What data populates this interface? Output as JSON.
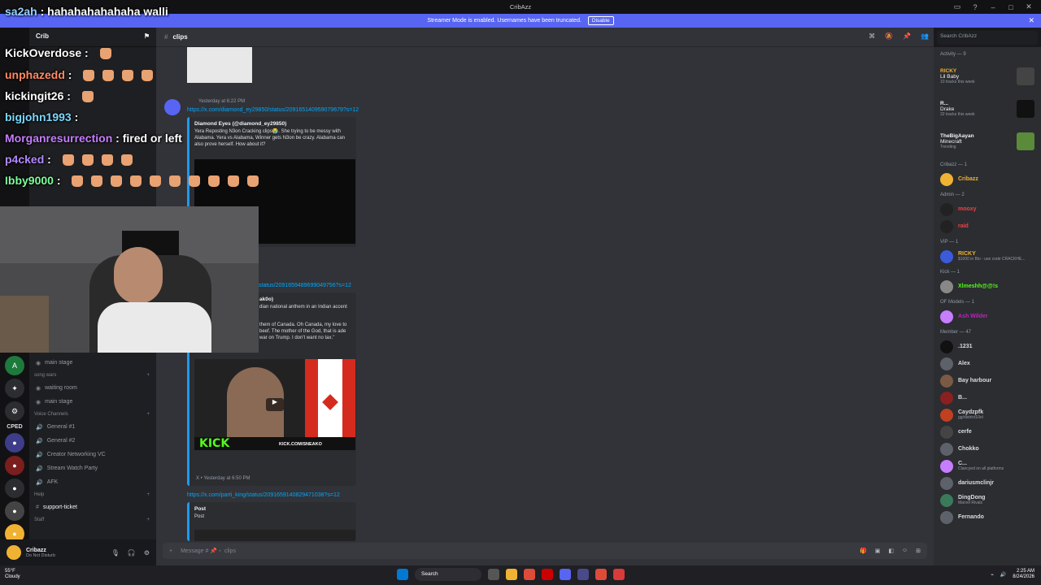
{
  "window": {
    "title": "CribAzz"
  },
  "banner": {
    "message": "Streamer Mode is enabled. Usernames have been truncated.",
    "button": "Disable"
  },
  "server": {
    "name": "Crib"
  },
  "channels": {
    "items": [
      "main stage",
      "waiting room",
      "main stage"
    ],
    "category_song": "song wars",
    "category_voice": "Voice Channels",
    "voice": [
      "General #1",
      "General #2",
      "Creator Networking VC",
      "Stream Watch Party",
      "AFK"
    ],
    "category_help": "Help",
    "help_items": [
      "support-ticket"
    ],
    "category_staff": "Staff",
    "server_label": "CPED"
  },
  "user": {
    "name": "Cribazz",
    "status": "Do Not Disturb"
  },
  "channel_header": {
    "name": "clips"
  },
  "search": {
    "placeholder": "Search CribAzz"
  },
  "messages": {
    "link1": "https://x.com/diamond_ey29850/status/209165140959079679?s=12",
    "time1": "Yesterday at 6:22 PM",
    "embed1_author": "Diamond Eyes (@diamond_ey29850)",
    "embed1_text": "Yera Reposting N3on Cracking clips😭. She trying to be messy with Alabama. Yera vs Alabama, Winner gets N3on be crazy. Alabama can also prove herself. How about it?",
    "link2": "status/2091659489699049756?s=12",
    "embed2_author": "ak0o)",
    "embed2_text_a": "dian national anthem in an Indian accent",
    "embed2_text_b": "them of Canada. Oh Canada, my love to beef. The mother of the God, that is ade war on Trump. I don't want no tax.\"",
    "kick_text": "KICK",
    "kick_url": "KICK.COM/SNEAKO",
    "meta2": "X • Yesterday at 6:50 PM",
    "link3": "https://x.com/parti_king/status/2091659140829471038?s=12",
    "post_title": "Post",
    "post_sub": "Post",
    "composer_placeholder": "Message # 📌・ clips"
  },
  "members": {
    "activity_label": "Activity — 9",
    "activities": [
      {
        "name": "RICKY",
        "title": "Lil Baby",
        "sub": "10 tracks this week"
      },
      {
        "name": "R...",
        "title": "Drake",
        "sub": "32 tracks this week"
      },
      {
        "name": "TheBigAayan",
        "title": "Minecraft",
        "sub": "Trending"
      }
    ],
    "cribazz_label": "Cribazz — 1",
    "cribazz": "Cribazz",
    "admin_label": "Admin — 2",
    "admins": [
      "mooxy",
      "raid"
    ],
    "vip_label": "VIP — 1",
    "vip": {
      "name": "RICKY",
      "sub": "$1000 in Bio - use code CRACKHE..."
    },
    "kick_label": "Kick — 1",
    "kick": "Xlmeshh@@!s",
    "of_label": "OF Models — 1",
    "of": "Ash Wilder",
    "member_label": "Member — 47",
    "list": [
      {
        "name": ".1231",
        "sub": ""
      },
      {
        "name": "Alex",
        "sub": ""
      },
      {
        "name": "Bay harbour",
        "sub": ""
      },
      {
        "name": "B...",
        "sub": ""
      },
      {
        "name": "Caydzpfk",
        "sub": "gg/district10el"
      },
      {
        "name": "cerfe",
        "sub": ""
      },
      {
        "name": "Chokko",
        "sub": ""
      },
      {
        "name": "C...",
        "sub": "Clancyed on all platforms"
      },
      {
        "name": "dariusmclinjr",
        "sub": ""
      },
      {
        "name": "DingDong",
        "sub": "Marvel Rivals"
      },
      {
        "name": "Fernando",
        "sub": ""
      }
    ]
  },
  "chat": [
    {
      "user": "sa2ah",
      "color": "#9ad0ff",
      "text": "hahahahahahaha walli",
      "hands": 0
    },
    {
      "user": "KickOverdose",
      "color": "#ffffff",
      "text": "",
      "hands": 1
    },
    {
      "user": "unphazedd",
      "color": "#ff8a65",
      "text": "",
      "hands": 4
    },
    {
      "user": "kickingit26",
      "color": "#ffffff",
      "text": "",
      "hands": 1
    },
    {
      "user": "bigjohn1993",
      "color": "#7ad7ff",
      "text": "",
      "hands": 0
    },
    {
      "user": "Morganresurrection",
      "color": "#c77dff",
      "text": "fired or left",
      "hands": 0
    },
    {
      "user": "p4cked",
      "color": "#b388ff",
      "text": "",
      "hands": 4
    },
    {
      "user": "Ibby9000",
      "color": "#7dff9a",
      "text": "",
      "hands": 10
    }
  ],
  "taskbar": {
    "temp": "55°F",
    "weather": "Cloudy",
    "search": "Search",
    "time": "2:25 AM",
    "date": "8/24/2026"
  }
}
